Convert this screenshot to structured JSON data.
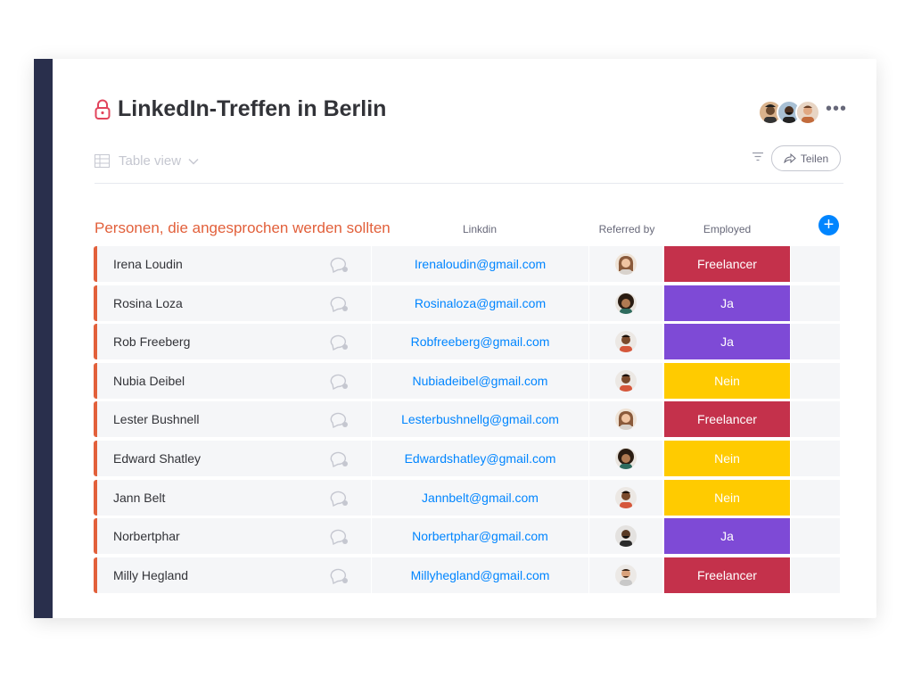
{
  "board": {
    "title": "LinkedIn-Treffen in Berlin",
    "view_label": "Table view",
    "share_label": "Teilen",
    "more_label": "•••",
    "add_label": "+"
  },
  "group": {
    "title": "Personen, die angesprochen werden sollten",
    "columns": {
      "linkdin": "Linkdin",
      "referred_by": "Referred by",
      "employed": "Employed"
    }
  },
  "colors": {
    "group_accent": "#e2603b",
    "sidebar": "#292f4c",
    "link": "#0085ff",
    "Freelancer": "#c4314b",
    "Ja": "#7e4ad6",
    "Nein": "#ffcb00"
  },
  "rows": [
    {
      "name": "Irena Loudin",
      "email": "Irenaloudin@gmail.com",
      "employed": "Freelancer",
      "avatar": "woman-light-icon"
    },
    {
      "name": "Rosina Loza",
      "email": "Rosinaloza@gmail.com",
      "employed": "Ja",
      "avatar": "woman-curly-icon"
    },
    {
      "name": "Rob Freeberg",
      "email": "Robfreeberg@gmail.com",
      "employed": "Ja",
      "avatar": "man-dark-icon"
    },
    {
      "name": "Nubia Deibel",
      "email": "Nubiadeibel@gmail.com",
      "employed": "Nein",
      "avatar": "man-dark-icon"
    },
    {
      "name": "Lester Bushnell",
      "email": "Lesterbushnellg@gmail.com",
      "employed": "Freelancer",
      "avatar": "woman-light-icon"
    },
    {
      "name": "Edward Shatley",
      "email": "Edwardshatley@gmail.com",
      "employed": "Nein",
      "avatar": "woman-curly-icon"
    },
    {
      "name": "Jann Belt",
      "email": "Jannbelt@gmail.com",
      "employed": "Nein",
      "avatar": "man-dark-icon"
    },
    {
      "name": "Norbertphar",
      "email": "Norbertphar@gmail.com",
      "employed": "Ja",
      "avatar": "man-beard-icon"
    },
    {
      "name": "Milly Hegland",
      "email": "Millyhegland@gmail.com",
      "employed": "Freelancer",
      "avatar": "man-glasses-icon"
    }
  ]
}
